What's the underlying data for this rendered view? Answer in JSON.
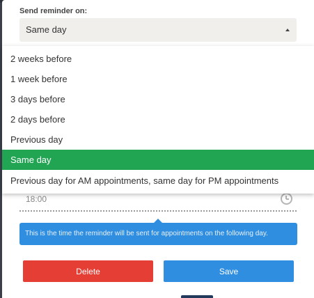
{
  "form": {
    "reminder_label": "Send reminder on:",
    "reminder_value": "Same day",
    "time_value": "18:00",
    "info_text": "This is the time the reminder will be sent for appointments on the following day."
  },
  "dropdown": {
    "options": [
      "2 weeks before",
      "1 week before",
      "3 days before",
      "2 days before",
      "Previous day",
      "Same day",
      "Previous day for AM appointments, same day for PM appointments"
    ],
    "selected": "Same day"
  },
  "buttons": {
    "delete_label": "Delete",
    "save_label": "Save"
  },
  "colors": {
    "selected_option": "#22a553",
    "delete": "#e53e35",
    "save": "#2f8ee0",
    "info": "#2f8ee0"
  },
  "icons": {
    "time": "clock-icon",
    "select_toggle": "caret-up-icon"
  }
}
